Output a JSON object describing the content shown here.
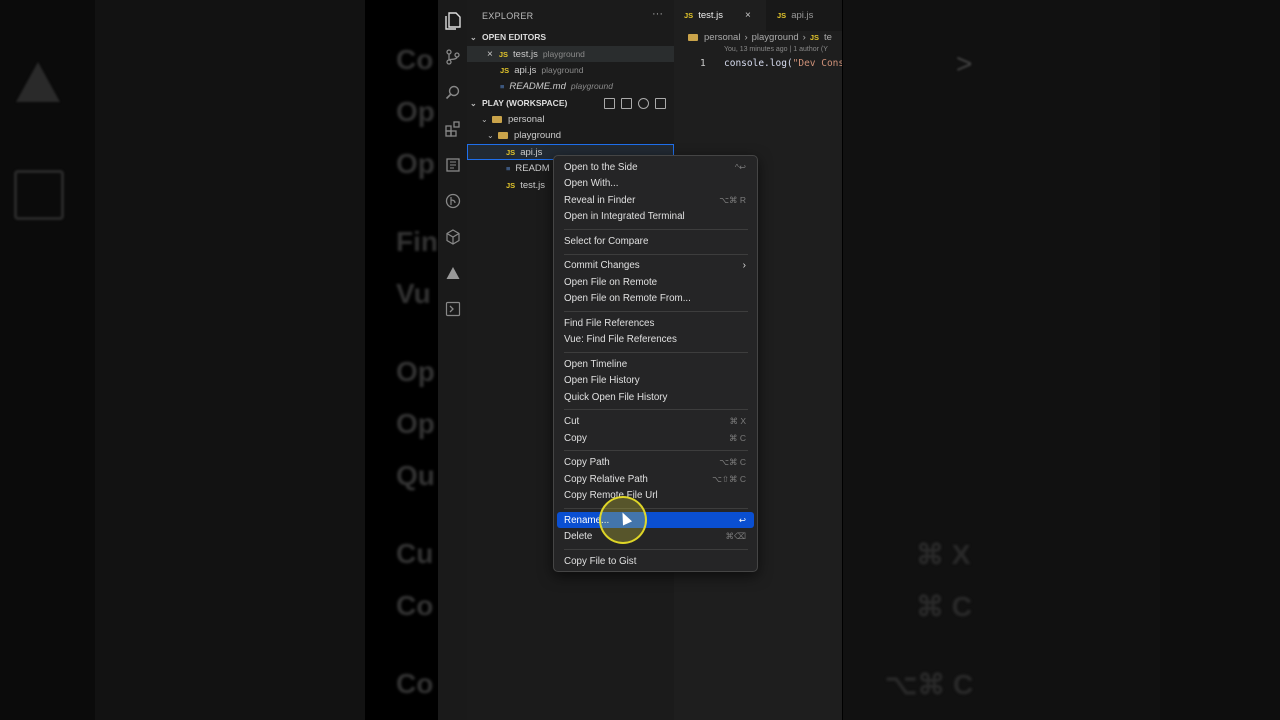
{
  "background": {
    "left_words": [
      "Co",
      "Op",
      "Op",
      "Fin",
      "Vu",
      "Op",
      "Op",
      "Qu",
      "Cu",
      "Co",
      "Co"
    ],
    "right_shortcuts": [
      "⌘ X",
      "⌘ C",
      "⌥⌘ C"
    ]
  },
  "sidebar": {
    "title": "EXPLORER",
    "more": "···",
    "open_editors_label": "OPEN EDITORS",
    "open_editors": [
      {
        "name": "test.js",
        "folder": "playground"
      },
      {
        "name": "api.js",
        "folder": "playground"
      },
      {
        "name": "README.md",
        "folder": "playground"
      }
    ],
    "workspace_label": "PLAY (WORKSPACE)",
    "tree": {
      "root": "personal",
      "folder": "playground",
      "files": [
        "api.js",
        "READM",
        "test.js"
      ]
    }
  },
  "editor": {
    "tabs": [
      {
        "name": "test.js",
        "close": "×"
      },
      {
        "name": "api.js"
      }
    ],
    "breadcrumb": [
      "personal",
      "playground",
      "te"
    ],
    "blame": "You, 13 minutes ago | 1 author (Y",
    "line_number": "1",
    "code_fn": "console.log(",
    "code_str": "\"Dev Conso"
  },
  "context_menu": {
    "items": [
      {
        "label": "Open to the Side",
        "shortcut": "^↩"
      },
      {
        "label": "Open With..."
      },
      {
        "label": "Reveal in Finder",
        "shortcut": "⌥⌘ R"
      },
      {
        "label": "Open in Integrated Terminal"
      },
      {
        "label": "Select for Compare"
      },
      {
        "label": "Commit Changes",
        "submenu": "›"
      },
      {
        "label": "Open File on Remote"
      },
      {
        "label": "Open File on Remote From..."
      },
      {
        "label": "Find File References"
      },
      {
        "label": "Vue: Find File References"
      },
      {
        "label": "Open Timeline"
      },
      {
        "label": "Open File History"
      },
      {
        "label": "Quick Open File History"
      },
      {
        "label": "Cut",
        "shortcut": "⌘ X"
      },
      {
        "label": "Copy",
        "shortcut": "⌘ C"
      },
      {
        "label": "Copy Path",
        "shortcut": "⌥⌘ C"
      },
      {
        "label": "Copy Relative Path",
        "shortcut": "⌥⇧⌘ C"
      },
      {
        "label": "Copy Remote File Url"
      },
      {
        "label": "Rename...",
        "shortcut": "↩"
      },
      {
        "label": "Delete",
        "shortcut": "⌘⌫"
      },
      {
        "label": "Copy File to Gist"
      }
    ],
    "highlighted": "Rename..."
  },
  "colors": {
    "accent": "#0a4fd1",
    "js_icon": "#e2c52b",
    "cursor_ring": "#e6dc28"
  }
}
